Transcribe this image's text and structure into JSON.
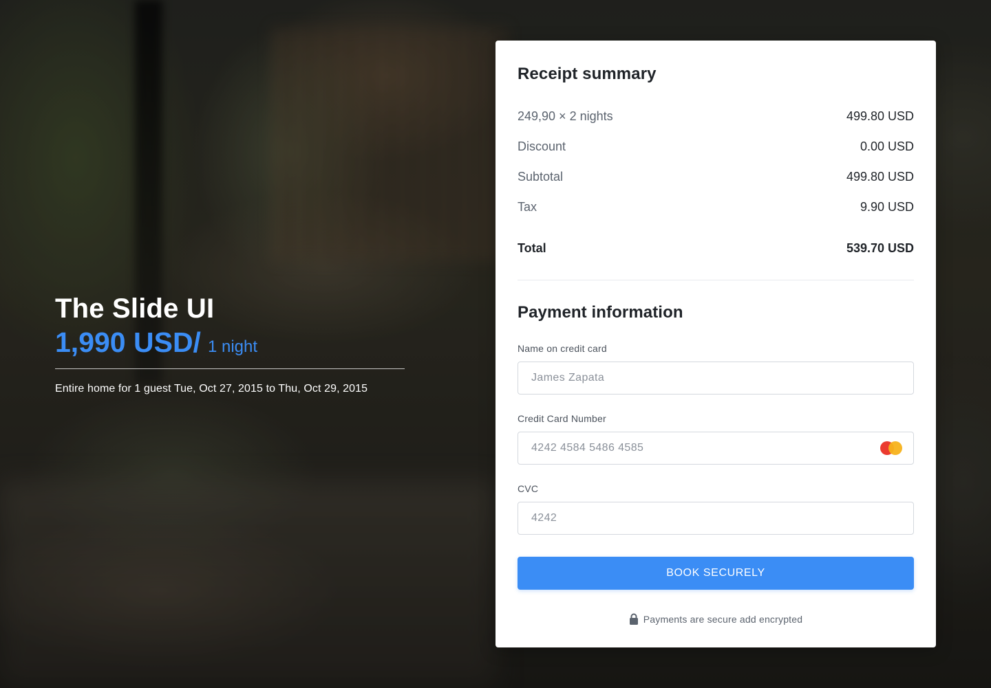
{
  "hero": {
    "title": "The Slide UI",
    "price": "1,990 USD/",
    "per": "1 night",
    "description": "Entire home for 1 guest Tue, Oct 27, 2015 to Thu, Oct 29, 2015"
  },
  "receipt": {
    "title": "Receipt summary",
    "rows": [
      {
        "label": "249,90 × 2 nights",
        "value": "499.80 USD"
      },
      {
        "label": "Discount",
        "value": "0.00 USD"
      },
      {
        "label": "Subtotal",
        "value": "499.80 USD"
      },
      {
        "label": "Tax",
        "value": "9.90 USD"
      }
    ],
    "total": {
      "label": "Total",
      "value": "539.70 USD"
    }
  },
  "payment": {
    "title": "Payment information",
    "name": {
      "label": "Name on credit card",
      "placeholder": "James Zapata"
    },
    "card_number": {
      "label": "Credit Card Number",
      "placeholder": "4242 4584 5486 4585",
      "icon": "mastercard-icon"
    },
    "cvc": {
      "label": "CVC",
      "placeholder": "4242"
    },
    "button": "BOOK SECURELY",
    "secure_note": "Payments are secure add encrypted",
    "secure_icon": "lock-icon"
  },
  "colors": {
    "accent": "#3b8df5",
    "card_red": "#eb3b2f",
    "card_yellow": "#f7b21b"
  }
}
